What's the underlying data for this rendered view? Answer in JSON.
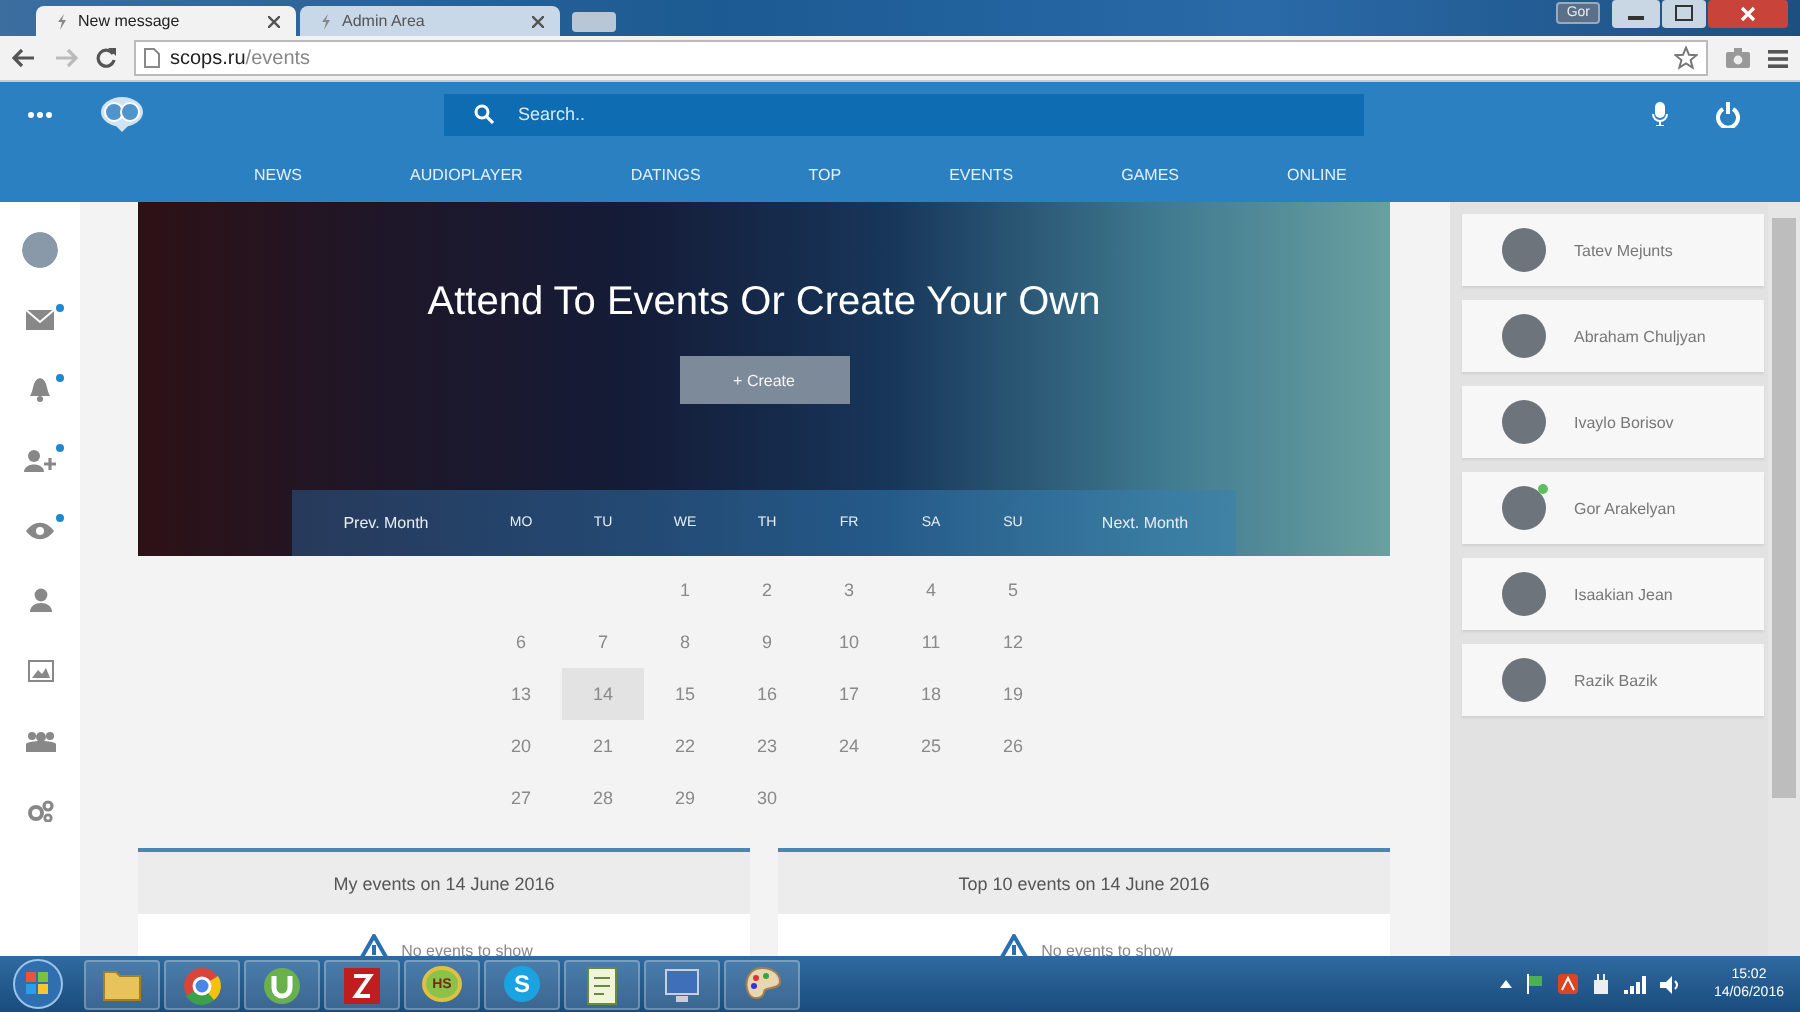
{
  "browser": {
    "tabs": [
      {
        "title": "New message",
        "selected": true
      },
      {
        "title": "Admin Area",
        "selected": false
      }
    ],
    "user_badge": "Gor",
    "address": {
      "host": "scops.ru",
      "path": "/events"
    }
  },
  "header": {
    "search": {
      "placeholder": "Search.."
    },
    "nav": [
      {
        "label": "NEWS"
      },
      {
        "label": "AUDIOPLAYER"
      },
      {
        "label": "DATINGS"
      },
      {
        "label": "TOP"
      },
      {
        "label": "EVENTS"
      },
      {
        "label": "GAMES"
      },
      {
        "label": "ONLINE"
      }
    ]
  },
  "sidebar": {
    "items": [
      {
        "kind": "avatar",
        "unread": false
      },
      {
        "kind": "mail",
        "unread": true
      },
      {
        "kind": "bell",
        "unread": true
      },
      {
        "kind": "add-user",
        "unread": true
      },
      {
        "kind": "eye",
        "unread": true
      },
      {
        "kind": "user",
        "unread": false
      },
      {
        "kind": "image",
        "unread": false
      },
      {
        "kind": "group",
        "unread": false
      },
      {
        "kind": "gears",
        "unread": false
      }
    ]
  },
  "hero": {
    "title": "Attend To Events Or Create Your Own",
    "create_button": "+ Create"
  },
  "calendar": {
    "prev": "Prev. Month",
    "next": "Next. Month",
    "weekdays": [
      "MO",
      "TU",
      "WE",
      "TH",
      "FR",
      "SA",
      "SU"
    ],
    "weeks": [
      [
        {
          "label": "1",
          "selected": false
        },
        {
          "label": "2",
          "selected": false
        },
        {
          "label": "3",
          "selected": false
        },
        {
          "label": "4",
          "selected": false
        },
        {
          "label": "5",
          "selected": false
        }
      ],
      [
        {
          "label": "6",
          "selected": false
        },
        {
          "label": "7",
          "selected": false
        },
        {
          "label": "8",
          "selected": false
        },
        {
          "label": "9",
          "selected": false
        },
        {
          "label": "10",
          "selected": false
        },
        {
          "label": "11",
          "selected": false
        },
        {
          "label": "12",
          "selected": false
        }
      ],
      [
        {
          "label": "13",
          "selected": false
        },
        {
          "label": "14",
          "selected": true
        },
        {
          "label": "15",
          "selected": false
        },
        {
          "label": "16",
          "selected": false
        },
        {
          "label": "17",
          "selected": false
        },
        {
          "label": "18",
          "selected": false
        },
        {
          "label": "19",
          "selected": false
        }
      ],
      [
        {
          "label": "20",
          "selected": false
        },
        {
          "label": "21",
          "selected": false
        },
        {
          "label": "22",
          "selected": false
        },
        {
          "label": "23",
          "selected": false
        },
        {
          "label": "24",
          "selected": false
        },
        {
          "label": "25",
          "selected": false
        },
        {
          "label": "26",
          "selected": false
        }
      ],
      [
        {
          "label": "27",
          "selected": false
        },
        {
          "label": "28",
          "selected": false
        },
        {
          "label": "29",
          "selected": false
        },
        {
          "label": "30",
          "selected": false
        }
      ]
    ]
  },
  "event_panels": [
    {
      "title": "My events on 14 June 2016",
      "empty_message": "No events to show"
    },
    {
      "title": "Top 10 events on 14 June 2016",
      "empty_message": "No events to show"
    }
  ],
  "friends": [
    {
      "name": "Tatev Mejunts",
      "online": false
    },
    {
      "name": "Abraham Chuljyan",
      "online": false
    },
    {
      "name": "Ivaylo Borisov",
      "online": false
    },
    {
      "name": "Gor Arakelyan",
      "online": true
    },
    {
      "name": "Isaakian Jean",
      "online": false
    },
    {
      "name": "Razik Bazik",
      "online": false
    }
  ],
  "taskbar": {
    "apps": [
      {
        "kind": "folder"
      },
      {
        "kind": "chrome"
      },
      {
        "kind": "utorrent"
      },
      {
        "kind": "filezilla"
      },
      {
        "kind": "badge",
        "label": "HS"
      },
      {
        "kind": "skype",
        "label": "S"
      },
      {
        "kind": "notepad"
      },
      {
        "kind": "monitor"
      },
      {
        "kind": "palette"
      }
    ],
    "time": "15:02",
    "date": "14/06/2016"
  }
}
